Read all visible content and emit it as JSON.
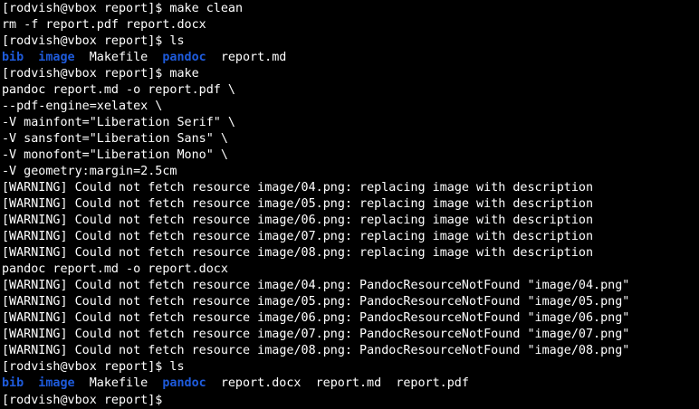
{
  "terminal": {
    "colors": {
      "background": "#000000",
      "text": "#ffffff",
      "directory": "#1e5bdc"
    },
    "lines": [
      {
        "kind": "text",
        "text": "[rodvish@vbox report]$ make clean"
      },
      {
        "kind": "text",
        "text": "rm -f report.pdf report.docx"
      },
      {
        "kind": "text",
        "text": "[rodvish@vbox report]$ ls"
      },
      {
        "kind": "ls",
        "entries": [
          {
            "name": "bib",
            "type": "dir"
          },
          {
            "name": "image",
            "type": "dir"
          },
          {
            "name": "Makefile",
            "type": "file"
          },
          {
            "name": "pandoc",
            "type": "dir"
          },
          {
            "name": "report.md",
            "type": "file"
          }
        ]
      },
      {
        "kind": "text",
        "text": "[rodvish@vbox report]$ make"
      },
      {
        "kind": "text",
        "text": "pandoc report.md -o report.pdf \\"
      },
      {
        "kind": "text",
        "text": "--pdf-engine=xelatex \\"
      },
      {
        "kind": "text",
        "text": "-V mainfont=\"Liberation Serif\" \\"
      },
      {
        "kind": "text",
        "text": "-V sansfont=\"Liberation Sans\" \\"
      },
      {
        "kind": "text",
        "text": "-V monofont=\"Liberation Mono\" \\"
      },
      {
        "kind": "text",
        "text": "-V geometry:margin=2.5cm"
      },
      {
        "kind": "text",
        "text": "[WARNING] Could not fetch resource image/04.png: replacing image with description"
      },
      {
        "kind": "text",
        "text": "[WARNING] Could not fetch resource image/05.png: replacing image with description"
      },
      {
        "kind": "text",
        "text": "[WARNING] Could not fetch resource image/06.png: replacing image with description"
      },
      {
        "kind": "text",
        "text": "[WARNING] Could not fetch resource image/07.png: replacing image with description"
      },
      {
        "kind": "text",
        "text": "[WARNING] Could not fetch resource image/08.png: replacing image with description"
      },
      {
        "kind": "text",
        "text": "pandoc report.md -o report.docx"
      },
      {
        "kind": "text",
        "text": "[WARNING] Could not fetch resource image/04.png: PandocResourceNotFound \"image/04.png\""
      },
      {
        "kind": "text",
        "text": "[WARNING] Could not fetch resource image/05.png: PandocResourceNotFound \"image/05.png\""
      },
      {
        "kind": "text",
        "text": "[WARNING] Could not fetch resource image/06.png: PandocResourceNotFound \"image/06.png\""
      },
      {
        "kind": "text",
        "text": "[WARNING] Could not fetch resource image/07.png: PandocResourceNotFound \"image/07.png\""
      },
      {
        "kind": "text",
        "text": "[WARNING] Could not fetch resource image/08.png: PandocResourceNotFound \"image/08.png\""
      },
      {
        "kind": "text",
        "text": "[rodvish@vbox report]$ ls"
      },
      {
        "kind": "ls",
        "entries": [
          {
            "name": "bib",
            "type": "dir"
          },
          {
            "name": "image",
            "type": "dir"
          },
          {
            "name": "Makefile",
            "type": "file"
          },
          {
            "name": "pandoc",
            "type": "dir"
          },
          {
            "name": "report.docx",
            "type": "file"
          },
          {
            "name": "report.md",
            "type": "file"
          },
          {
            "name": "report.pdf",
            "type": "file"
          }
        ]
      },
      {
        "kind": "prompt",
        "text": "[rodvish@vbox report]$ "
      }
    ]
  }
}
